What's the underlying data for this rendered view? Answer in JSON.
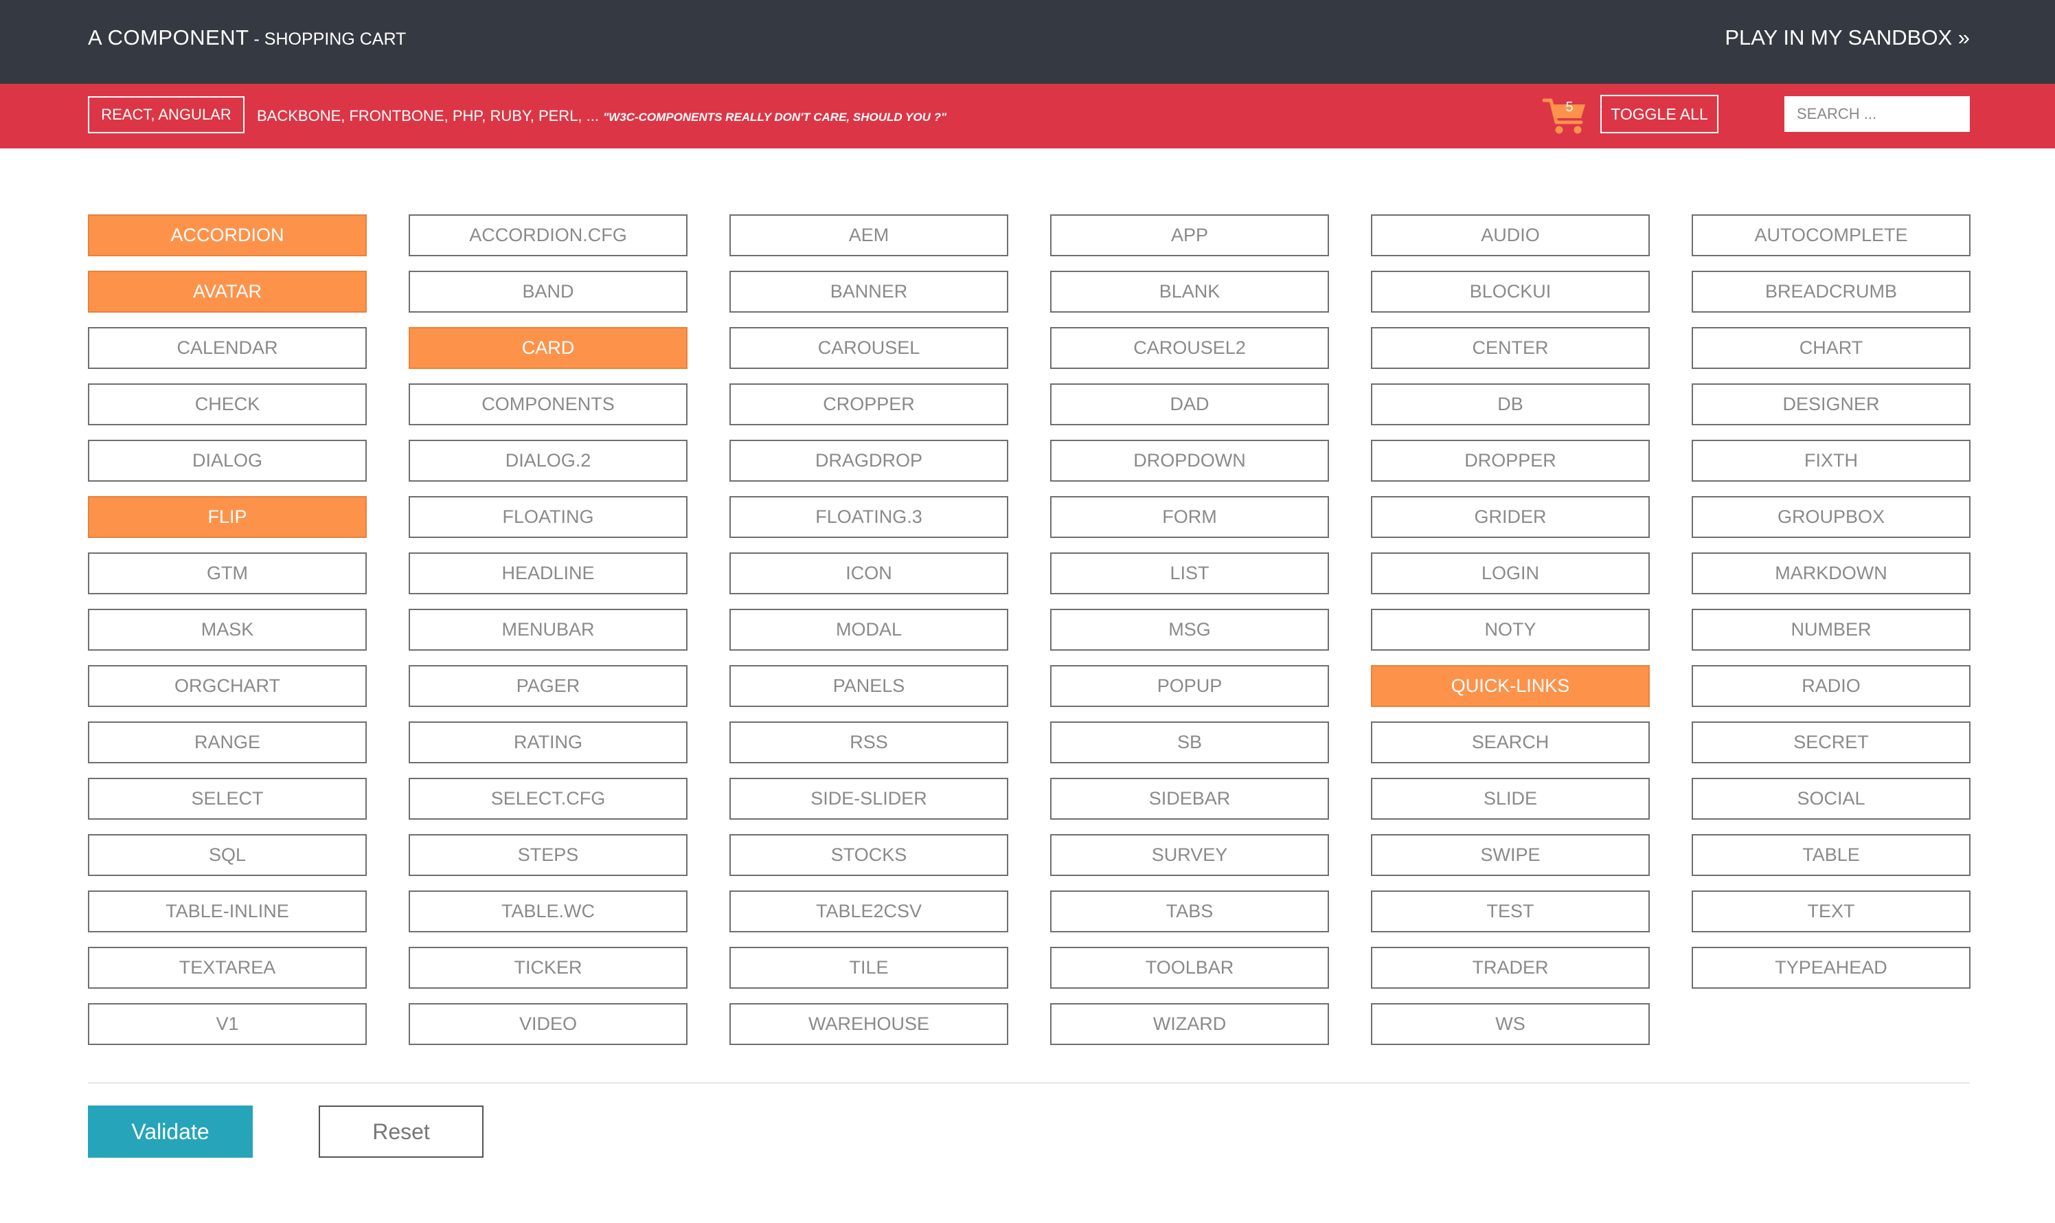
{
  "header": {
    "title": "A COMPONENT",
    "subtitle": " - SHOPPING CART",
    "sandbox_link": "PLAY IN MY SANDBOX »"
  },
  "toolbar": {
    "frameworks_button": "REACT, ANGULAR",
    "frameworks_list": "BACKBONE, FRONTBONE, PHP, RUBY, PERL, ... ",
    "quote": "\"W3C-COMPONENTS REALLY DON'T CARE, SHOULD YOU ?\"",
    "cart_count": "5",
    "toggle_all": "TOGGLE ALL",
    "search_placeholder": "SEARCH ...",
    "cart_icon": "shopping-cart-icon"
  },
  "colors": {
    "header_bg": "#353a42",
    "toolbar_bg": "#dc3646",
    "selected": "#fd934b",
    "validate": "#26a4b9"
  },
  "components": [
    {
      "label": "ACCORDION",
      "selected": true
    },
    {
      "label": "ACCORDION.CFG",
      "selected": false
    },
    {
      "label": "AEM",
      "selected": false
    },
    {
      "label": "APP",
      "selected": false
    },
    {
      "label": "AUDIO",
      "selected": false
    },
    {
      "label": "AUTOCOMPLETE",
      "selected": false
    },
    {
      "label": "AVATAR",
      "selected": true
    },
    {
      "label": "BAND",
      "selected": false
    },
    {
      "label": "BANNER",
      "selected": false
    },
    {
      "label": "BLANK",
      "selected": false
    },
    {
      "label": "BLOCKUI",
      "selected": false
    },
    {
      "label": "BREADCRUMB",
      "selected": false
    },
    {
      "label": "CALENDAR",
      "selected": false
    },
    {
      "label": "CARD",
      "selected": true
    },
    {
      "label": "CAROUSEL",
      "selected": false
    },
    {
      "label": "CAROUSEL2",
      "selected": false
    },
    {
      "label": "CENTER",
      "selected": false
    },
    {
      "label": "CHART",
      "selected": false
    },
    {
      "label": "CHECK",
      "selected": false
    },
    {
      "label": "COMPONENTS",
      "selected": false
    },
    {
      "label": "CROPPER",
      "selected": false
    },
    {
      "label": "DAD",
      "selected": false
    },
    {
      "label": "DB",
      "selected": false
    },
    {
      "label": "DESIGNER",
      "selected": false
    },
    {
      "label": "DIALOG",
      "selected": false
    },
    {
      "label": "DIALOG.2",
      "selected": false
    },
    {
      "label": "DRAGDROP",
      "selected": false
    },
    {
      "label": "DROPDOWN",
      "selected": false
    },
    {
      "label": "DROPPER",
      "selected": false
    },
    {
      "label": "FIXTH",
      "selected": false
    },
    {
      "label": "FLIP",
      "selected": true
    },
    {
      "label": "FLOATING",
      "selected": false
    },
    {
      "label": "FLOATING.3",
      "selected": false
    },
    {
      "label": "FORM",
      "selected": false
    },
    {
      "label": "GRIDER",
      "selected": false
    },
    {
      "label": "GROUPBOX",
      "selected": false
    },
    {
      "label": "GTM",
      "selected": false
    },
    {
      "label": "HEADLINE",
      "selected": false
    },
    {
      "label": "ICON",
      "selected": false
    },
    {
      "label": "LIST",
      "selected": false
    },
    {
      "label": "LOGIN",
      "selected": false
    },
    {
      "label": "MARKDOWN",
      "selected": false
    },
    {
      "label": "MASK",
      "selected": false
    },
    {
      "label": "MENUBAR",
      "selected": false
    },
    {
      "label": "MODAL",
      "selected": false
    },
    {
      "label": "MSG",
      "selected": false
    },
    {
      "label": "NOTY",
      "selected": false
    },
    {
      "label": "NUMBER",
      "selected": false
    },
    {
      "label": "ORGCHART",
      "selected": false
    },
    {
      "label": "PAGER",
      "selected": false
    },
    {
      "label": "PANELS",
      "selected": false
    },
    {
      "label": "POPUP",
      "selected": false
    },
    {
      "label": "QUICK-LINKS",
      "selected": true
    },
    {
      "label": "RADIO",
      "selected": false
    },
    {
      "label": "RANGE",
      "selected": false
    },
    {
      "label": "RATING",
      "selected": false
    },
    {
      "label": "RSS",
      "selected": false
    },
    {
      "label": "SB",
      "selected": false
    },
    {
      "label": "SEARCH",
      "selected": false
    },
    {
      "label": "SECRET",
      "selected": false
    },
    {
      "label": "SELECT",
      "selected": false
    },
    {
      "label": "SELECT.CFG",
      "selected": false
    },
    {
      "label": "SIDE-SLIDER",
      "selected": false
    },
    {
      "label": "SIDEBAR",
      "selected": false
    },
    {
      "label": "SLIDE",
      "selected": false
    },
    {
      "label": "SOCIAL",
      "selected": false
    },
    {
      "label": "SQL",
      "selected": false
    },
    {
      "label": "STEPS",
      "selected": false
    },
    {
      "label": "STOCKS",
      "selected": false
    },
    {
      "label": "SURVEY",
      "selected": false
    },
    {
      "label": "SWIPE",
      "selected": false
    },
    {
      "label": "TABLE",
      "selected": false
    },
    {
      "label": "TABLE-INLINE",
      "selected": false
    },
    {
      "label": "TABLE.WC",
      "selected": false
    },
    {
      "label": "TABLE2CSV",
      "selected": false
    },
    {
      "label": "TABS",
      "selected": false
    },
    {
      "label": "TEST",
      "selected": false
    },
    {
      "label": "TEXT",
      "selected": false
    },
    {
      "label": "TEXTAREA",
      "selected": false
    },
    {
      "label": "TICKER",
      "selected": false
    },
    {
      "label": "TILE",
      "selected": false
    },
    {
      "label": "TOOLBAR",
      "selected": false
    },
    {
      "label": "TRADER",
      "selected": false
    },
    {
      "label": "TYPEAHEAD",
      "selected": false
    },
    {
      "label": "V1",
      "selected": false
    },
    {
      "label": "VIDEO",
      "selected": false
    },
    {
      "label": "WAREHOUSE",
      "selected": false
    },
    {
      "label": "WIZARD",
      "selected": false
    },
    {
      "label": "WS",
      "selected": false
    }
  ],
  "actions": {
    "validate": "Validate",
    "reset": "Reset"
  }
}
